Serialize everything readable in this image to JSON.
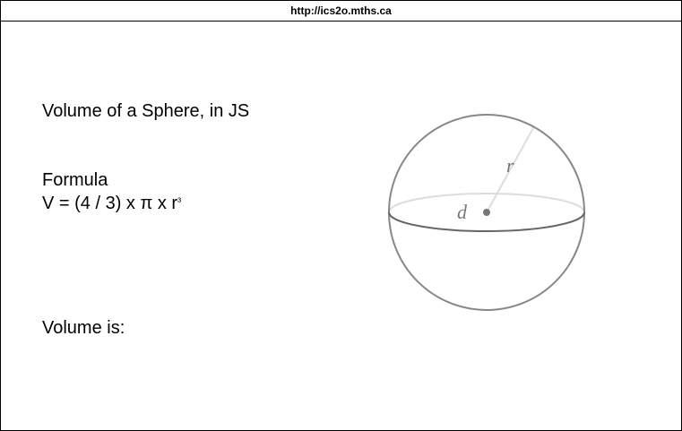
{
  "browser": {
    "url": "http://ics2o.mths.ca"
  },
  "page": {
    "title": "Volume of a Sphere, in JS",
    "formula_heading": "Formula",
    "formula_text": "V = (4 / 3) x π x r",
    "formula_exponent": "³",
    "volume_label": "Volume is:"
  },
  "diagram": {
    "radius_label": "r",
    "diameter_label": "d"
  }
}
